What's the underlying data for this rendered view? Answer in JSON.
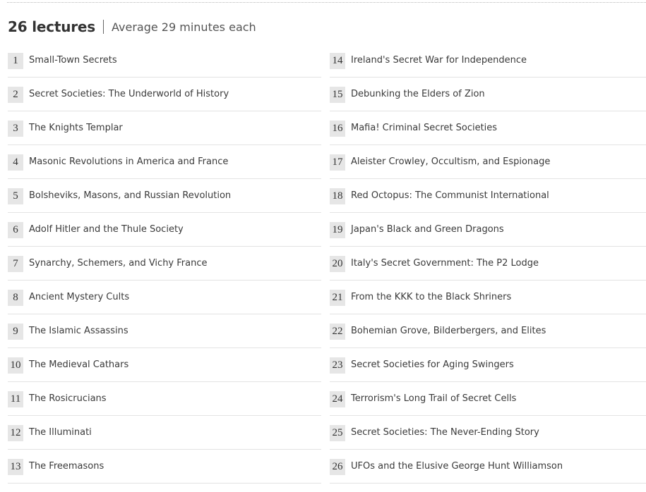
{
  "header": {
    "count": "26 lectures",
    "average": "Average 29 minutes each"
  },
  "lectures": [
    {
      "num": "1",
      "title": "Small-Town Secrets"
    },
    {
      "num": "2",
      "title": "Secret Societies: The Underworld of History"
    },
    {
      "num": "3",
      "title": "The Knights Templar"
    },
    {
      "num": "4",
      "title": "Masonic Revolutions in America and France"
    },
    {
      "num": "5",
      "title": "Bolsheviks, Masons, and Russian Revolution"
    },
    {
      "num": "6",
      "title": "Adolf Hitler and the Thule Society"
    },
    {
      "num": "7",
      "title": "Synarchy, Schemers, and Vichy France"
    },
    {
      "num": "8",
      "title": "Ancient Mystery Cults"
    },
    {
      "num": "9",
      "title": "The Islamic Assassins"
    },
    {
      "num": "10",
      "title": "The Medieval Cathars"
    },
    {
      "num": "11",
      "title": "The Rosicrucians"
    },
    {
      "num": "12",
      "title": "The Illuminati"
    },
    {
      "num": "13",
      "title": "The Freemasons"
    },
    {
      "num": "14",
      "title": "Ireland's Secret War for Independence"
    },
    {
      "num": "15",
      "title": "Debunking the Elders of Zion"
    },
    {
      "num": "16",
      "title": "Mafia! Criminal Secret Societies"
    },
    {
      "num": "17",
      "title": "Aleister Crowley, Occultism, and Espionage"
    },
    {
      "num": "18",
      "title": "Red Octopus: The Communist International"
    },
    {
      "num": "19",
      "title": "Japan's Black and Green Dragons"
    },
    {
      "num": "20",
      "title": "Italy's Secret Government: The P2 Lodge"
    },
    {
      "num": "21",
      "title": "From the KKK to the Black Shriners"
    },
    {
      "num": "22",
      "title": "Bohemian Grove, Bilderbergers, and Elites"
    },
    {
      "num": "23",
      "title": "Secret Societies for Aging Swingers"
    },
    {
      "num": "24",
      "title": "Terrorism's Long Trail of Secret Cells"
    },
    {
      "num": "25",
      "title": "Secret Societies: The Never-Ending Story"
    },
    {
      "num": "26",
      "title": "UFOs and the Elusive George Hunt Williamson"
    }
  ]
}
